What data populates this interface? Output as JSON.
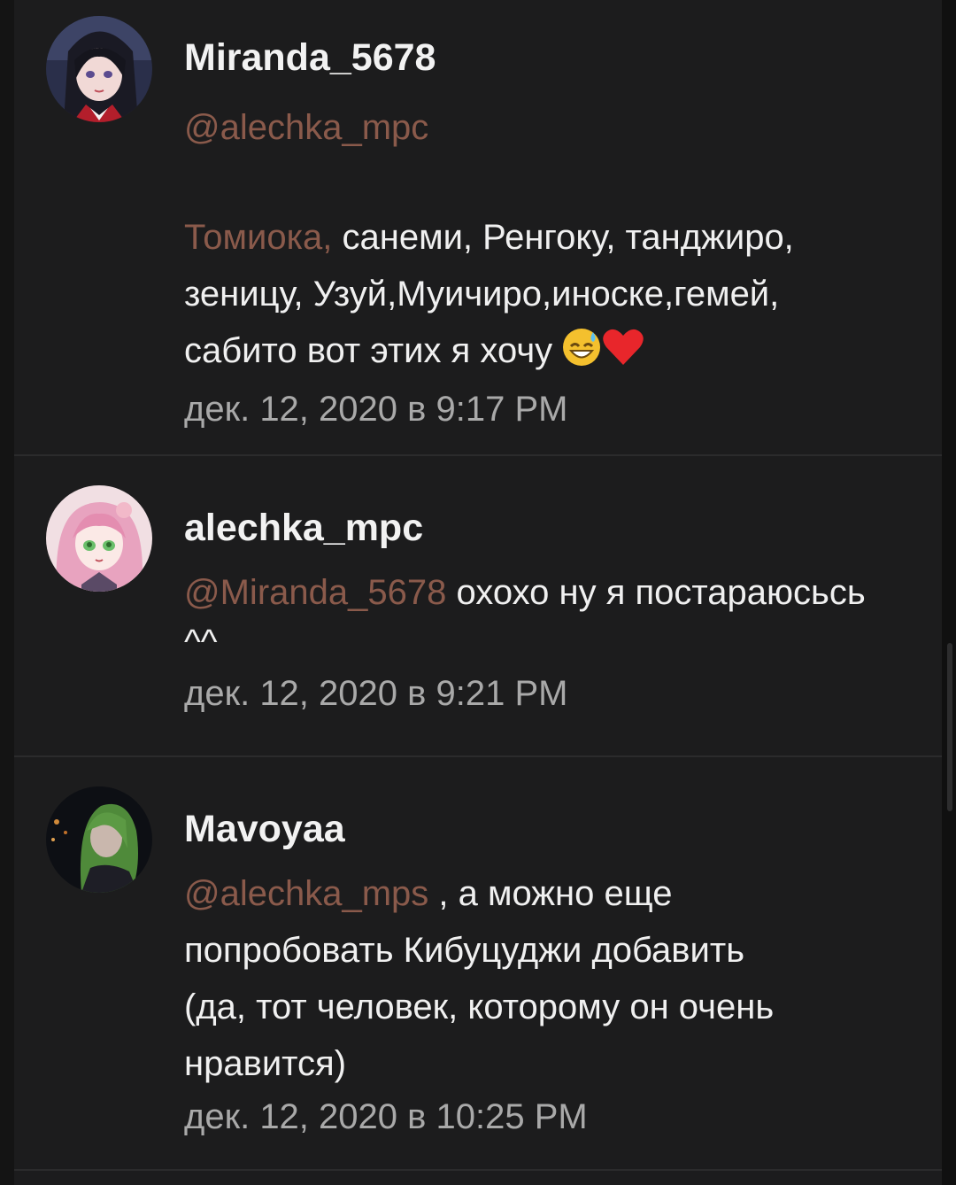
{
  "comments": [
    {
      "username": "Miranda_5678",
      "mention": "@alechka_mpc",
      "text_accent": "Томиока,",
      "text_line1": " санеми, Ренгоку, танджиро,",
      "text_line2": "зеницу, Узуй,Муичиро,иноске,гемей,",
      "text_line3": "сабито вот этих я хочу",
      "emojis": [
        "sweat-smile-emoji",
        "red-heart-emoji"
      ],
      "timestamp": "дек. 12, 2020 в 9:17 PM"
    },
    {
      "username": "alechka_mpc",
      "mention": "@Miranda_5678",
      "text_line1": " охохо ну я постараюсьсь",
      "text_line2": "^^",
      "timestamp": "дек. 12, 2020 в 9:21 PM"
    },
    {
      "username": "Mavoyaa",
      "mention": "@alechka_mps",
      "text_line1": " , а можно еще",
      "text_line2": "попробовать Кибуцуджи добавить",
      "text_line3": "(да,  тот человек, которому он очень",
      "text_line4": "нравится)",
      "timestamp": "дек. 12, 2020 в 10:25 PM"
    }
  ],
  "colors": {
    "background": "#1c1c1d",
    "mention": "#8a5a4b",
    "username": "#f2f2f2",
    "text": "#f0f0f0",
    "timestamp": "#a9a9a9"
  }
}
